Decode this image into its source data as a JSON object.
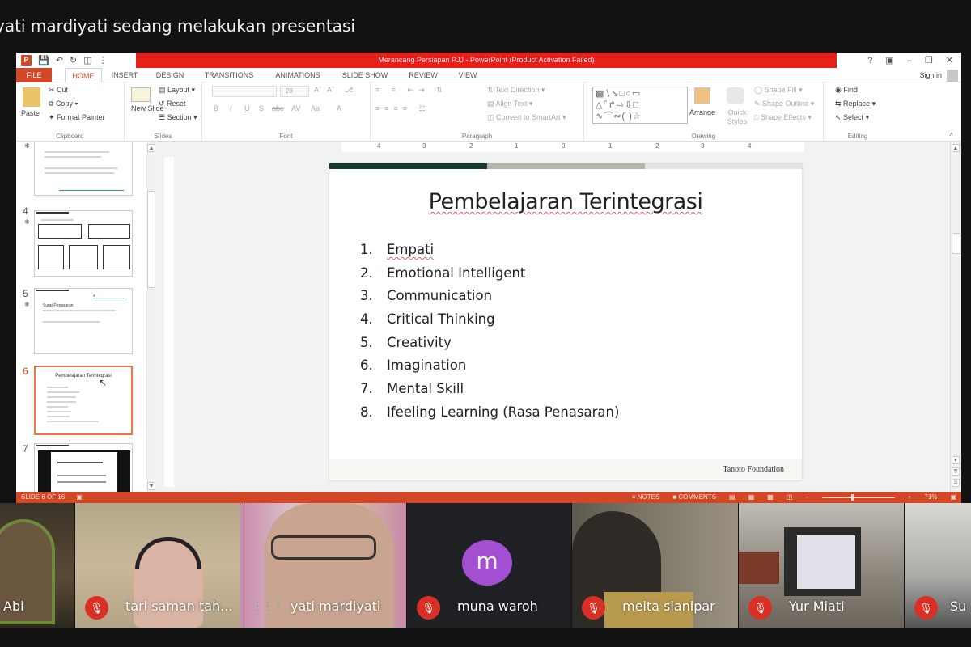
{
  "meeting": {
    "presenting_banner": "yati mardiyati sedang melakukan presentasi"
  },
  "powerpoint": {
    "window_title": "Merancang Persiapan PJJ -  PowerPoint (Product Activation Failed)",
    "window_controls": [
      "?",
      "ribbon-display",
      "minimize",
      "restore",
      "close"
    ],
    "sign_in": "Sign in",
    "tabs": [
      {
        "label": "FILE"
      },
      {
        "label": "HOME",
        "active": true
      },
      {
        "label": "INSERT"
      },
      {
        "label": "DESIGN"
      },
      {
        "label": "TRANSITIONS"
      },
      {
        "label": "ANIMATIONS"
      },
      {
        "label": "SLIDE SHOW"
      },
      {
        "label": "REVIEW"
      },
      {
        "label": "VIEW"
      }
    ],
    "ribbon": {
      "clipboard": {
        "label": "Clipboard",
        "paste": "Paste",
        "cut": "Cut",
        "copy": "Copy",
        "format_painter": "Format Painter"
      },
      "slides": {
        "label": "Slides",
        "new_slide": "New Slide",
        "layout": "Layout",
        "reset": "Reset",
        "section": "Section"
      },
      "font": {
        "label": "Font",
        "font_size": "28",
        "bold": "B",
        "italic": "I",
        "underline": "U",
        "strike": "S",
        "char_spacing": "AV",
        "change_case": "Aa",
        "font_color": "A"
      },
      "paragraph": {
        "label": "Paragraph",
        "text_direction": "Text Direction",
        "align_text": "Align Text",
        "convert_smartart": "Convert to SmartArt"
      },
      "drawing": {
        "label": "Drawing",
        "arrange": "Arrange",
        "quick_styles": "Quick Styles",
        "shape_fill": "Shape Fill",
        "shape_outline": "Shape Outline",
        "shape_effects": "Shape Effects"
      },
      "editing": {
        "label": "Editing",
        "find": "Find",
        "replace": "Replace",
        "select": "Select"
      }
    },
    "thumbnails": [
      {
        "number": "",
        "title": "",
        "active": false
      },
      {
        "number": "4",
        "title": "",
        "active": false
      },
      {
        "number": "5",
        "title": "Surat Penasaran",
        "active": false
      },
      {
        "number": "6",
        "title": "Pembelajaran Terintegrasi",
        "active": true
      },
      {
        "number": "7",
        "title": "",
        "active": false
      }
    ],
    "ruler_ticks": [
      "4",
      "3",
      "2",
      "1",
      "0",
      "1",
      "2",
      "3",
      "4"
    ],
    "slide": {
      "title": "Pembelajaran Terintegrasi",
      "items": [
        {
          "num": "1.",
          "text": "Empati"
        },
        {
          "num": "2.",
          "text": "Emotional Intelligent"
        },
        {
          "num": "3.",
          "text": "Communication"
        },
        {
          "num": "4.",
          "text": "Critical Thinking"
        },
        {
          "num": "5.",
          "text": "Creativity"
        },
        {
          "num": "6.",
          "text": "Imagination"
        },
        {
          "num": "7.",
          "text": "Mental Skill"
        },
        {
          "num": "8.",
          "text": "Ifeeling Learning (Rasa Penasaran)"
        }
      ],
      "footer": "Tanoto Foundation",
      "accent_colors": [
        "#183a33",
        "#b5b3ab",
        "#e3e3e3"
      ]
    },
    "status": {
      "slide_counter": "SLIDE 6 OF 16",
      "notes": "NOTES",
      "comments": "COMMENTS",
      "zoom_percent": "71%",
      "zoom_fraction": 0.4
    }
  },
  "participants": [
    {
      "name": "Abi",
      "muted": false
    },
    {
      "name": "tari saman tah...",
      "muted": true
    },
    {
      "name": "yati mardiyati",
      "muted": false,
      "speaking": true
    },
    {
      "name": "muna waroh",
      "muted": true,
      "initial": "m"
    },
    {
      "name": "meita sianipar",
      "muted": true
    },
    {
      "name": "Yur Miati",
      "muted": true
    },
    {
      "name": "Su",
      "muted": true
    }
  ],
  "colors": {
    "ppt_accent": "#d24726",
    "title_bar_red": "#e8201a",
    "mic_off_red": "#d93025",
    "avatar_purple": "#a34fd1"
  }
}
